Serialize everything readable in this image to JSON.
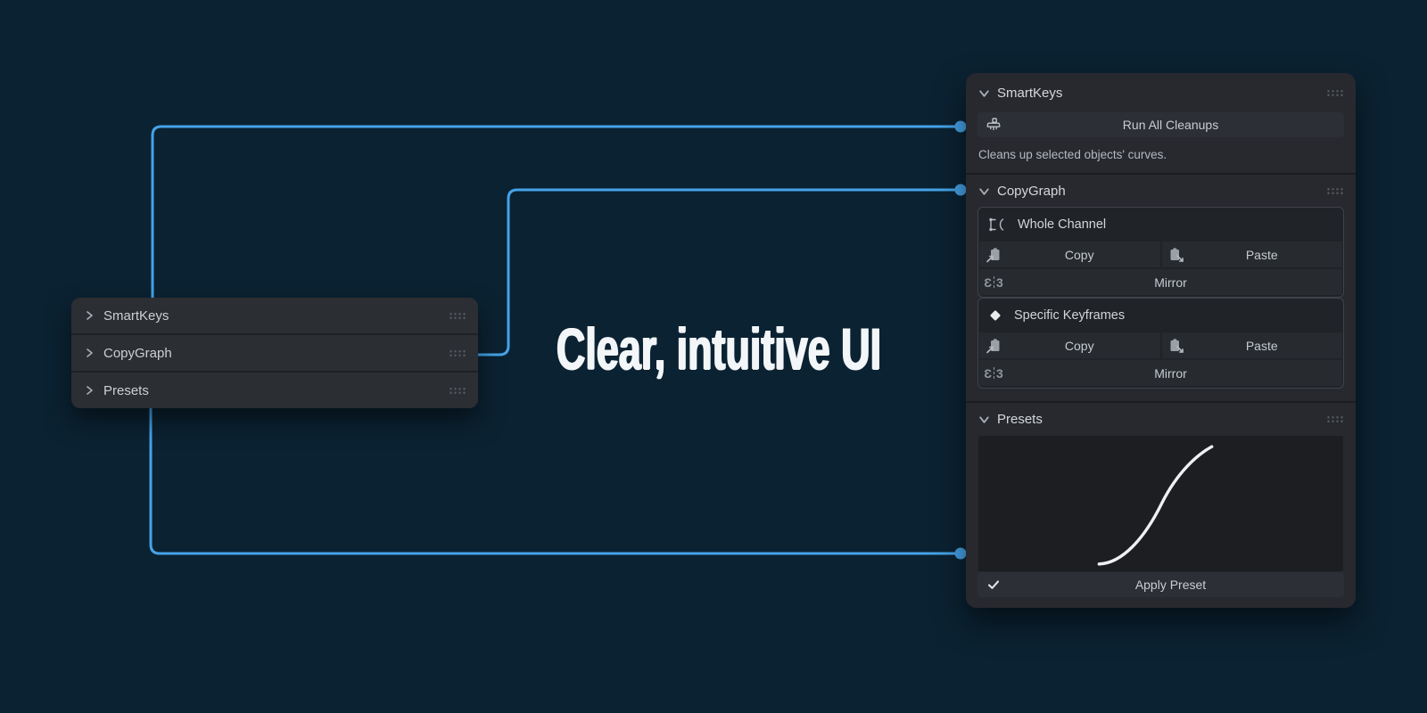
{
  "headline": {
    "text": "Clear, intuitive UI"
  },
  "colors": {
    "background": "#0b2232",
    "panel": "#27292e",
    "accent_blue": "#45a3e8",
    "curve_white": "#eef1f3"
  },
  "icons": {
    "collapsed_chevron": "chevron-right-icon",
    "expanded_chevron": "chevron-down-icon",
    "drag_handle": "drag-dots-icon",
    "run_cleanups": "brush-icon",
    "whole_channel": "fcurve-channel-icon",
    "specific_keyframes": "keyframe-diamond-icon",
    "copy": "clipboard-copy-icon",
    "paste": "clipboard-paste-icon",
    "mirror": "butterfly-mirror-icon",
    "apply": "check-icon",
    "mirror_glyph_left": "Ɛ",
    "mirror_glyph_right": "3"
  },
  "left_panels": {
    "items": [
      {
        "label": "SmartKeys"
      },
      {
        "label": "CopyGraph"
      },
      {
        "label": "Presets"
      }
    ]
  },
  "right_panel": {
    "smartkeys": {
      "title": "SmartKeys",
      "run_button_label": "Run All Cleanups",
      "description": "Cleans up selected objects' curves."
    },
    "copygraph": {
      "title": "CopyGraph",
      "groups": [
        {
          "title": "Whole Channel",
          "copy_label": "Copy",
          "paste_label": "Paste",
          "mirror_label": "Mirror"
        },
        {
          "title": "Specific Keyframes",
          "copy_label": "Copy",
          "paste_label": "Paste",
          "mirror_label": "Mirror"
        }
      ]
    },
    "presets": {
      "title": "Presets",
      "apply_button_label": "Apply Preset"
    }
  }
}
